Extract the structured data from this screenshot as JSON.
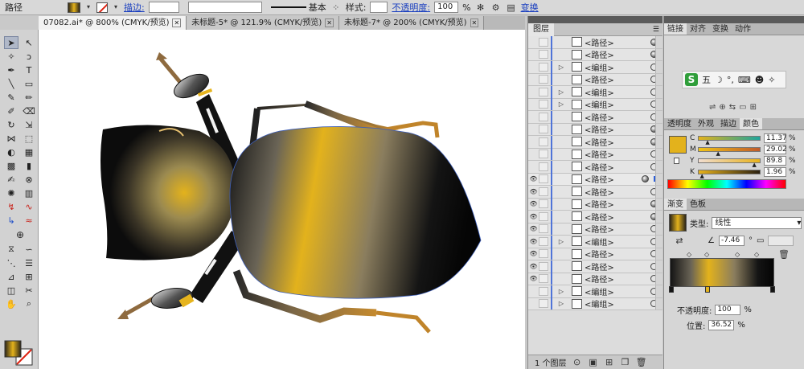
{
  "control_bar": {
    "object_type": "路径",
    "stroke_label": "描边:",
    "brush_label": "基本",
    "style_label": "样式:",
    "opacity_label": "不透明度:",
    "opacity_value": "100",
    "opacity_unit": "%",
    "transform_label": "变换"
  },
  "tabs": [
    {
      "label": "07082.ai* @ 800% (CMYK/预览)",
      "active": true
    },
    {
      "label": "未标题-5* @ 121.9% (CMYK/预览)",
      "active": false
    },
    {
      "label": "未标题-7* @ 200% (CMYK/预览)",
      "active": false
    }
  ],
  "layers_panel": {
    "title": "图层",
    "rows": [
      {
        "name": "<路径>",
        "visible": false,
        "expand": false,
        "target": "filled"
      },
      {
        "name": "<路径>",
        "visible": false,
        "expand": false,
        "target": "filled"
      },
      {
        "name": "<编组>",
        "visible": false,
        "expand": true,
        "target": "empty"
      },
      {
        "name": "<路径>",
        "visible": false,
        "expand": false,
        "target": "empty"
      },
      {
        "name": "<编组>",
        "visible": false,
        "expand": true,
        "target": "empty"
      },
      {
        "name": "<编组>",
        "visible": false,
        "expand": true,
        "target": "empty"
      },
      {
        "name": "<路径>",
        "visible": false,
        "expand": false,
        "target": "empty"
      },
      {
        "name": "<路径>",
        "visible": false,
        "expand": false,
        "target": "filled"
      },
      {
        "name": "<路径>",
        "visible": false,
        "expand": false,
        "target": "filled"
      },
      {
        "name": "<路径>",
        "visible": false,
        "expand": false,
        "target": "empty"
      },
      {
        "name": "<路径>",
        "visible": false,
        "expand": false,
        "target": "empty"
      },
      {
        "name": "<路径>",
        "visible": true,
        "expand": false,
        "target": "filled",
        "selected": true
      },
      {
        "name": "<路径>",
        "visible": true,
        "expand": false,
        "target": "empty"
      },
      {
        "name": "<路径>",
        "visible": true,
        "expand": false,
        "target": "filled"
      },
      {
        "name": "<路径>",
        "visible": true,
        "expand": false,
        "target": "filled"
      },
      {
        "name": "<路径>",
        "visible": true,
        "expand": false,
        "target": "empty"
      },
      {
        "name": "<编组>",
        "visible": true,
        "expand": true,
        "target": "empty"
      },
      {
        "name": "<路径>",
        "visible": true,
        "expand": false,
        "target": "empty"
      },
      {
        "name": "<路径>",
        "visible": true,
        "expand": false,
        "target": "empty"
      },
      {
        "name": "<路径>",
        "visible": true,
        "expand": false,
        "target": "empty"
      },
      {
        "name": "<编组>",
        "visible": false,
        "expand": true,
        "target": "empty"
      },
      {
        "name": "<编组>",
        "visible": false,
        "expand": true,
        "target": "empty"
      }
    ],
    "footer": "1 个图层"
  },
  "right_panels": {
    "top_tabs": [
      "链接",
      "对齐",
      "变换",
      "动作"
    ],
    "ime_logo": "S",
    "ime_label": "五",
    "color_tabs": [
      "透明度",
      "外观",
      "描边",
      "颜色"
    ],
    "cmyk": [
      {
        "label": "C",
        "value": "11.37",
        "unit": "%",
        "level": 0.1137
      },
      {
        "label": "M",
        "value": "29.02",
        "unit": "%",
        "level": 0.2902
      },
      {
        "label": "Y",
        "value": "89.8",
        "unit": "%",
        "level": 0.898
      },
      {
        "label": "K",
        "value": "1.96",
        "unit": "%",
        "level": 0.0196
      }
    ],
    "fill_color": "#e3b21c",
    "gradient_tabs": [
      "渐变",
      "色板"
    ],
    "type_label": "类型:",
    "type_value": "线性",
    "angle_value": "-7.46",
    "angle_unit": "°",
    "opacity_label": "不透明度:",
    "opacity_value": "100",
    "opacity_unit": "%",
    "position_label": "位置:",
    "position_value": "36.52",
    "position_unit": "%"
  }
}
